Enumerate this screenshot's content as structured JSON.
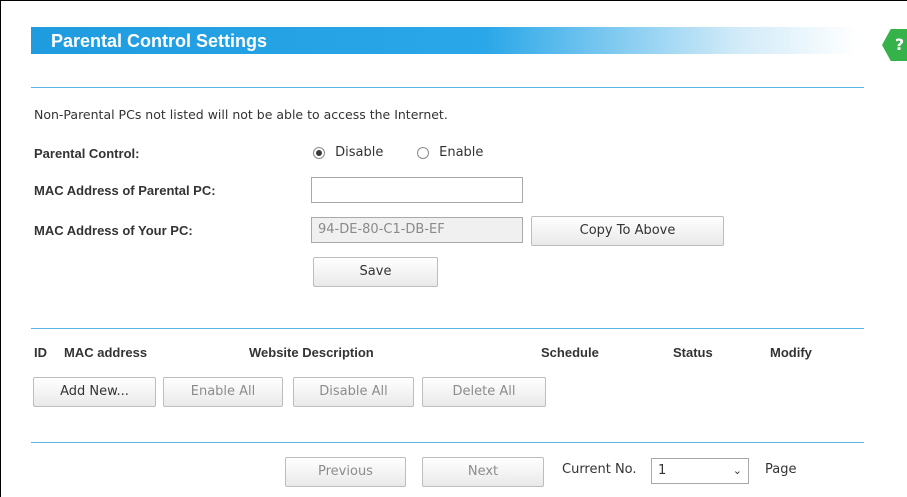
{
  "header": {
    "title": "Parental Control Settings",
    "help_glyph": "?"
  },
  "form": {
    "note": "Non-Parental PCs not listed will not be able to access the Internet.",
    "parental_control": {
      "label": "Parental Control:",
      "options": [
        {
          "label": "Disable",
          "checked": true
        },
        {
          "label": "Enable",
          "checked": false
        }
      ]
    },
    "parental_mac": {
      "label": "MAC Address of Parental PC:",
      "value": ""
    },
    "your_mac": {
      "label": "MAC Address of Your PC:",
      "value": "94-DE-80-C1-DB-EF"
    },
    "copy_button": "Copy To Above",
    "save_button": "Save"
  },
  "table": {
    "columns": [
      "ID",
      "MAC address",
      "Website Description",
      "Schedule",
      "Status",
      "Modify"
    ],
    "buttons": {
      "add_new": "Add New...",
      "enable_all": "Enable All",
      "disable_all": "Disable All",
      "delete_all": "Delete All"
    }
  },
  "pagination": {
    "previous": "Previous",
    "next": "Next",
    "current_label": "Current No.",
    "current_value": "1",
    "page_label": "Page"
  }
}
